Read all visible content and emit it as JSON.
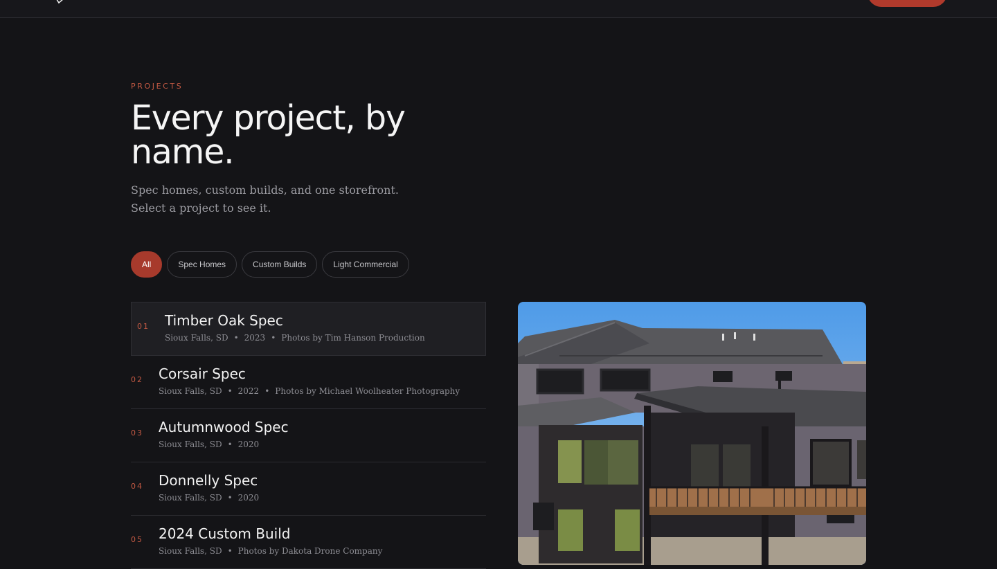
{
  "section": {
    "eyebrow": "PROJECTS",
    "title": "Every project, by name.",
    "subtitle": "Spec homes, custom builds, and one storefront. Select a project to see it."
  },
  "filters": [
    {
      "label": "All",
      "active": true
    },
    {
      "label": "Spec Homes",
      "active": false
    },
    {
      "label": "Custom Builds",
      "active": false
    },
    {
      "label": "Light Commercial",
      "active": false
    }
  ],
  "projects": [
    {
      "num": "01",
      "name": "Timber Oak Spec",
      "location": "Sioux Falls, SD",
      "year": "2023",
      "credit": "Photos by Tim Hanson Production",
      "selected": true
    },
    {
      "num": "02",
      "name": "Corsair Spec",
      "location": "Sioux Falls, SD",
      "year": "2022",
      "credit": "Photos by Michael Woolheater Photography",
      "selected": false
    },
    {
      "num": "03",
      "name": "Autumnwood Spec",
      "location": "Sioux Falls, SD",
      "year": "2020",
      "credit": "",
      "selected": false
    },
    {
      "num": "04",
      "name": "Donnelly Spec",
      "location": "Sioux Falls, SD",
      "year": "2020",
      "credit": "",
      "selected": false
    },
    {
      "num": "05",
      "name": "2024 Custom Build",
      "location": "Sioux Falls, SD",
      "year": "",
      "credit": "Photos by Dakota Drone Company",
      "selected": false
    }
  ],
  "preview": {
    "icon": "house-photo"
  },
  "colors": {
    "background": "#141417",
    "accent": "#a73a2c",
    "eyebrow": "#c65a44",
    "muted_text": "#9c9ca2"
  }
}
